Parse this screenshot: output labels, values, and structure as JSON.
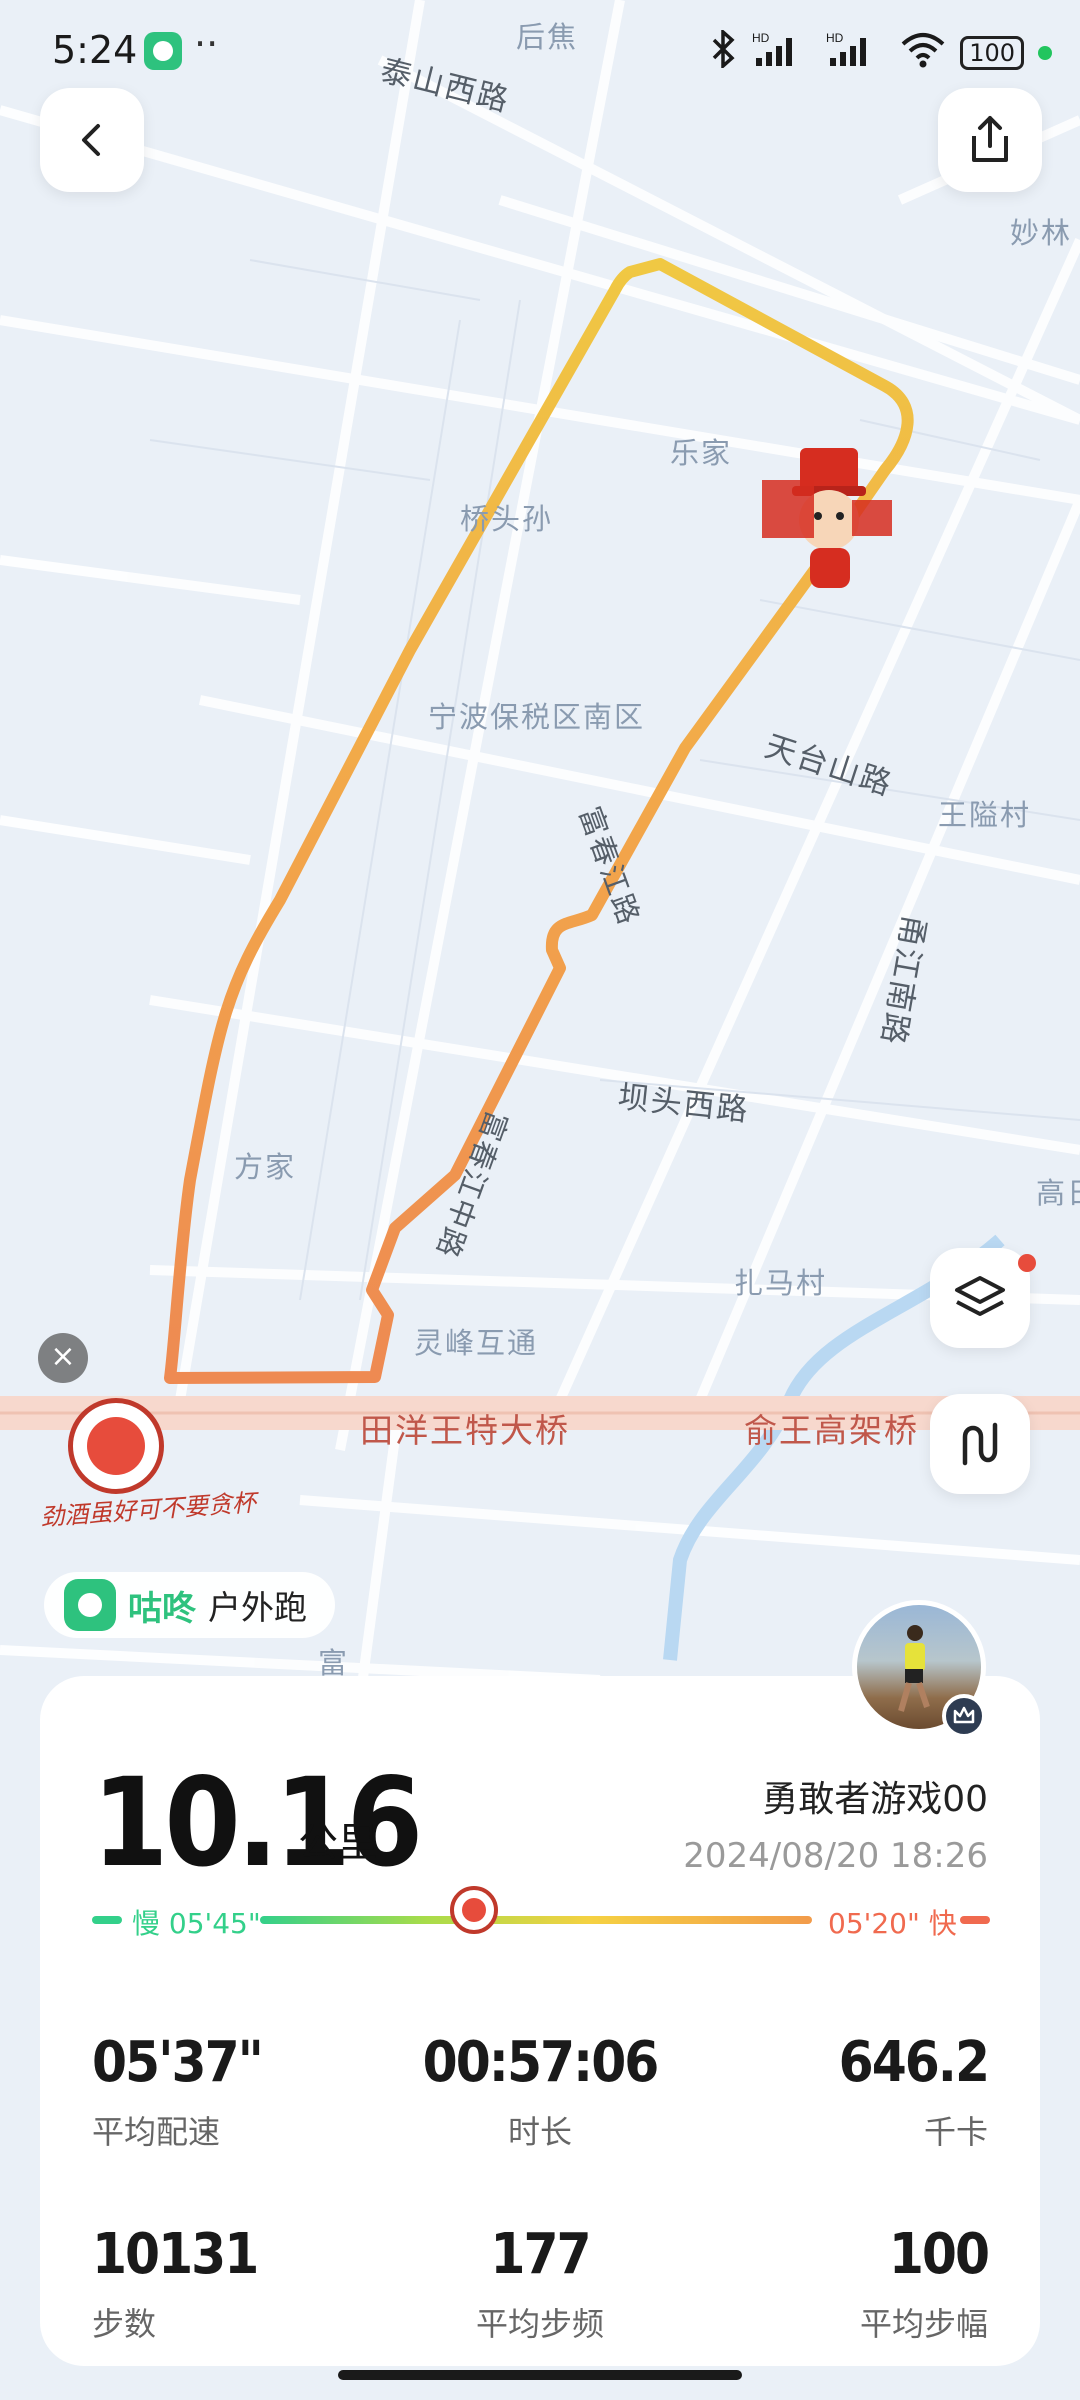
{
  "status_bar": {
    "time": "5:24",
    "dots": "··",
    "network": "HD",
    "battery": "100",
    "bluetooth_icon": "bluetooth-icon",
    "signal_icon": "signal-icon",
    "wifi_icon": "wifi-icon"
  },
  "map": {
    "labels": {
      "houjiao": "后焦",
      "taishan_west_rd": "泰山西路",
      "miaolin": "妙林",
      "lejia": "乐家",
      "qiaotousun": "桥头孙",
      "ningbo_bonded": "宁波保税区南区",
      "tiantaishan_rd": "天台山路",
      "wangyicun": "王隘村",
      "fuchunjiang_rd": "富春江路",
      "yongjiang_south_rd": "甬江南路",
      "batou_west_rd": "坝头西路",
      "fangjia": "方家",
      "gao": "高日",
      "fuchunjiang_middle_rd": "富春江中路",
      "zhamacun": "扎马村",
      "lingfeng_interchange": "灵峰互通",
      "tianyang_bridge": "田洋王特大桥",
      "yuwang_viaduct": "俞王高架桥",
      "fu": "富"
    },
    "route_colors": {
      "start": "#f0c843",
      "mid": "#f2a64a",
      "end": "#ee8a52"
    }
  },
  "ad": {
    "close": "×",
    "tagline": "劲酒虽好可不要贪杯"
  },
  "sport_chip": {
    "brand": "咕咚",
    "mode": "户外跑"
  },
  "summary": {
    "distance": "10.16",
    "distance_unit": "公里",
    "user_name": "勇敢者游戏00",
    "date": "2024/08/20 18:26",
    "pace_slow": "慢 05'45\"",
    "pace_fast": "05'20\" 快",
    "pace_colors": {
      "slow": "#33d08a",
      "fast": "#f06a4f"
    }
  },
  "stats": {
    "avg_pace": {
      "value": "05'37\"",
      "label": "平均配速"
    },
    "duration": {
      "value": "00:57:06",
      "label": "时长"
    },
    "calories": {
      "value": "646.2",
      "label": "千卡"
    },
    "steps": {
      "value": "10131",
      "label": "步数"
    },
    "cadence": {
      "value": "177",
      "label": "平均步频"
    },
    "stride": {
      "value": "100",
      "label": "平均步幅"
    }
  }
}
